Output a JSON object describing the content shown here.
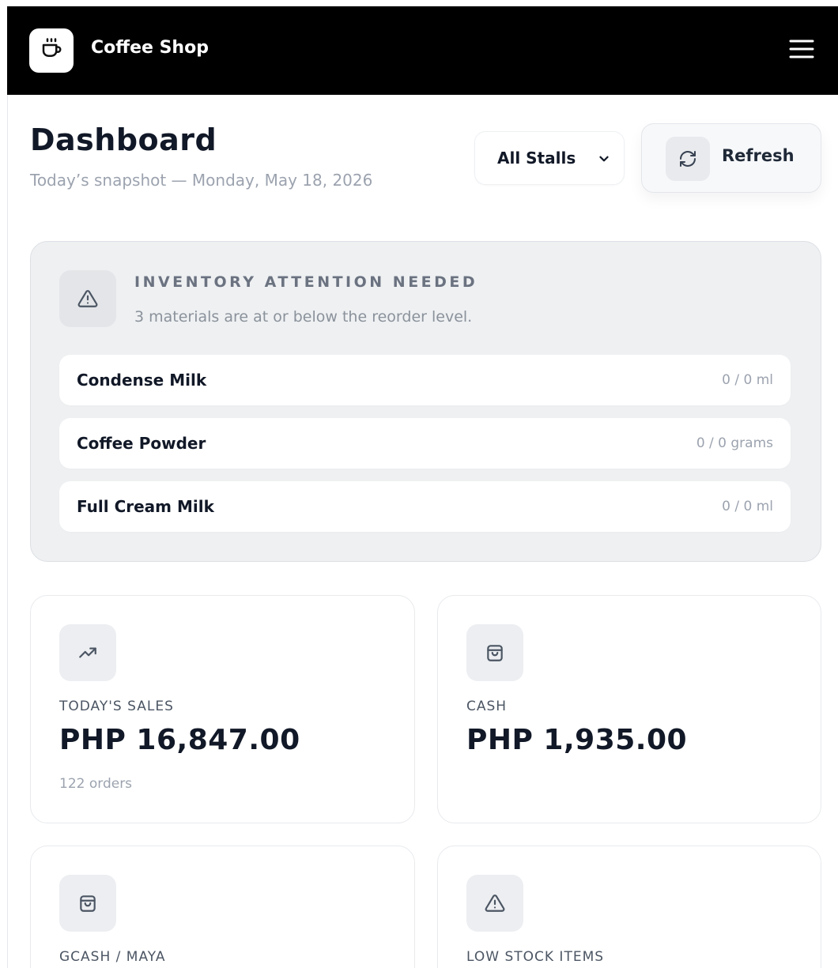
{
  "app": {
    "title": "Coffee Shop",
    "logo_icon": "coffee-cup-icon",
    "menu_icon": "hamburger-menu-icon"
  },
  "page": {
    "title": "Dashboard",
    "subtitle": "Today’s snapshot — Monday, May 18, 2026"
  },
  "controls": {
    "stall_filter": {
      "selected": "All Stalls",
      "icon": "chevron-down-icon"
    },
    "refresh": {
      "label": "Refresh",
      "icon": "refresh-icon"
    }
  },
  "inventory_alert": {
    "title": "INVENTORY ATTENTION NEEDED",
    "message": "3 materials are at or below the reorder level.",
    "icon": "warning-icon",
    "materials": [
      {
        "name": "Condense Milk",
        "quantity": "0 / 0 ml"
      },
      {
        "name": "Coffee Powder",
        "quantity": "0 / 0 grams"
      },
      {
        "name": "Full Cream Milk",
        "quantity": "0 / 0 ml"
      }
    ]
  },
  "stats": [
    {
      "label": "TODAY'S SALES",
      "value": "PHP 16,847.00",
      "note": "122 orders",
      "icon": "trending-up-icon"
    },
    {
      "label": "CASH",
      "value": "PHP 1,935.00",
      "note": "",
      "icon": "shopping-bag-icon"
    },
    {
      "label": "GCASH / MAYA",
      "value": "",
      "note": "",
      "icon": "shopping-bag-icon"
    },
    {
      "label": "LOW STOCK ITEMS",
      "value": "",
      "note": "",
      "icon": "warning-icon"
    }
  ],
  "colors": {
    "topbar": "#000000",
    "panel": "#eef0f2",
    "text_primary": "#111827",
    "text_muted": "#9ca3af"
  }
}
